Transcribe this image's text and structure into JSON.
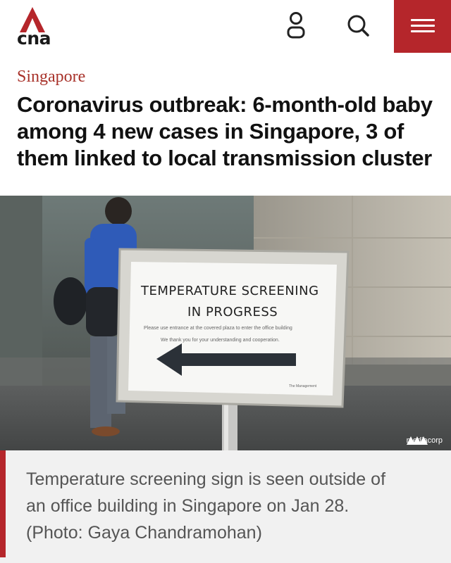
{
  "header": {
    "logo_text": "cna",
    "brand_color": "#b5262b",
    "icons": [
      "user-icon",
      "search-icon",
      "menu-icon"
    ]
  },
  "article": {
    "section": "Singapore",
    "headline": "Coronavirus outbreak: 6-month-old baby among 4 new cases in Singapore, 3 of them linked to local transmission cluster"
  },
  "photo": {
    "sign_line1": "TEMPERATURE SCREENING",
    "sign_line2": "IN PROGRESS",
    "sign_small1": "Please use entrance at the covered plaza to enter the office building",
    "sign_small2": "We thank you for your understanding and cooperation.",
    "sign_small3": "The Management",
    "watermark": "mediacorp"
  },
  "caption": {
    "text": "Temperature screening sign is seen outside of an office building in Singapore on Jan 28. (Photo: Gaya Chandramohan)"
  }
}
